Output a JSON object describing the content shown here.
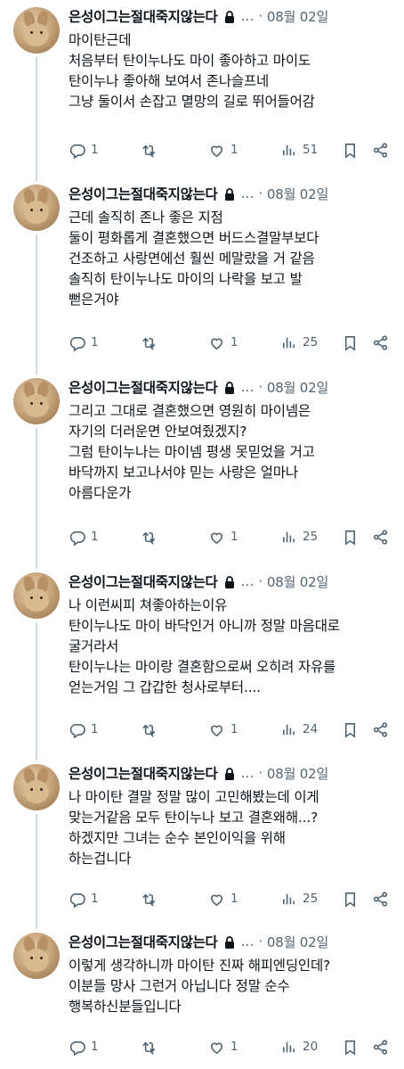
{
  "author": {
    "name": "은성이그는절대죽지않는다",
    "more": "…",
    "separator": "·",
    "date": "08월 02일"
  },
  "tweets": [
    {
      "lines": [
        "마이탄근데",
        "처음부터 탄이누나도 마이 좋아하고 마이도",
        "탄이누나 좋아해 보여서 존나슬프네",
        "그냥 둘이서 손잡고 멸망의 길로 뛰어들어감"
      ],
      "replies": "1",
      "likes": "1",
      "views": "51"
    },
    {
      "lines": [
        "근데 솔직히 존나 좋은 지점",
        "둘이 평화롭게 결혼했으면 버드스결말부보다",
        "건조하고 사랑면에선 훨씬 메말랐을 거 같음",
        "솔직히 탄이누나도 마이의 나락을 보고 발",
        "뻗은거야"
      ],
      "replies": "1",
      "likes": "1",
      "views": "25"
    },
    {
      "lines": [
        "그리고 그대로 결혼했으면 영원히 마이넴은",
        "자기의 더러운면 안보여줬겠지?",
        "그럼 탄이누나는 마이넴 평생 못믿었을 거고",
        "바닥까지 보고나서야 믿는 사랑은 얼마나",
        "아름다운가"
      ],
      "replies": "1",
      "likes": "1",
      "views": "25"
    },
    {
      "lines": [
        "나 이런씨피 쳐좋아하는이유",
        "탄이누나도 마이 바닥인거 아니까 정말 마음대로",
        "굴거라서",
        "탄이누나는 마이랑 결혼함으로써 오히려 자유를",
        "얻는거임 그 갑갑한 청사로부터...."
      ],
      "replies": "1",
      "likes": "1",
      "views": "24"
    },
    {
      "lines": [
        "나 마이탄 결말 정말 많이 고민해봤는데 이게",
        "맞는거같음 모두 탄이누나 보고 결혼왜해...?",
        "하겠지만 그녀는 순수 본인이익을 위해",
        "하는겁니다"
      ],
      "replies": "1",
      "likes": "1",
      "views": "25"
    },
    {
      "lines": [
        "이렇게 생각하니까 마이탄 진짜 해피엔딩인데?",
        "이분들 망사 그런거 아닙니다 정말 순수",
        "행복하신분들입니다"
      ],
      "replies": "1",
      "likes": "1",
      "views": "20"
    }
  ],
  "icons": {
    "reply": "reply-icon",
    "retweet": "retweet-icon",
    "like": "like-icon",
    "views": "views-icon",
    "bookmark": "bookmark-icon",
    "share": "share-icon",
    "lock": "lock-icon"
  },
  "colors": {
    "text": "#0f1419",
    "muted": "#536471",
    "line": "#cfd9de"
  }
}
